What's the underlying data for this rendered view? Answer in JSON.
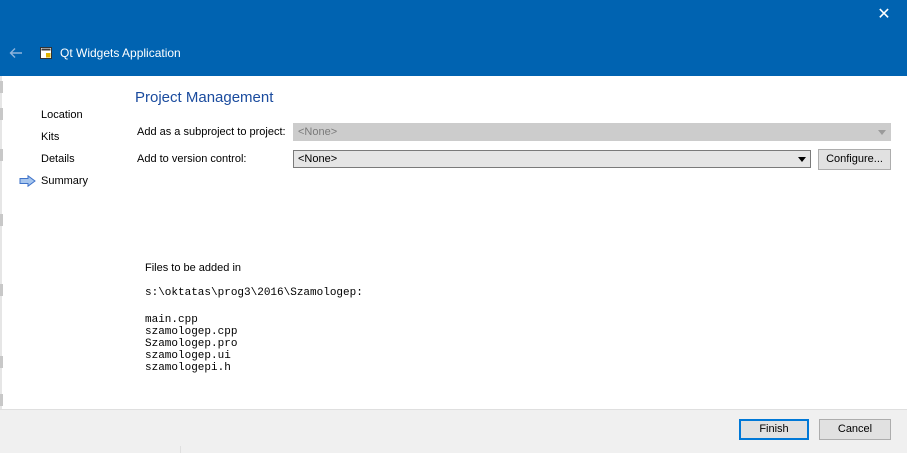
{
  "window": {
    "title": "Qt Widgets Application",
    "close_glyph": "✕",
    "back_icon": "back-arrow-icon",
    "app_icon": "qt-application-icon",
    "titlebar_color": "#0063b1"
  },
  "sidebar": {
    "items": [
      {
        "label": "Location"
      },
      {
        "label": "Kits"
      },
      {
        "label": "Details"
      },
      {
        "label": "Summary",
        "current": true
      }
    ]
  },
  "main": {
    "heading": "Project Management",
    "subproject": {
      "label": "Add as a subproject to project:",
      "value": "<None>",
      "enabled": false
    },
    "version_control": {
      "label": "Add to version control:",
      "value": "<None>",
      "configure_label": "Configure..."
    },
    "files": {
      "intro": "Files to be added in",
      "path": "s:\\oktatas\\prog3\\2016\\Szamologep:",
      "list": [
        "main.cpp",
        "szamologep.cpp",
        "Szamologep.pro",
        "szamologep.ui",
        "szamologepi.h"
      ]
    }
  },
  "footer": {
    "finish_label": "Finish",
    "cancel_label": "Cancel"
  }
}
